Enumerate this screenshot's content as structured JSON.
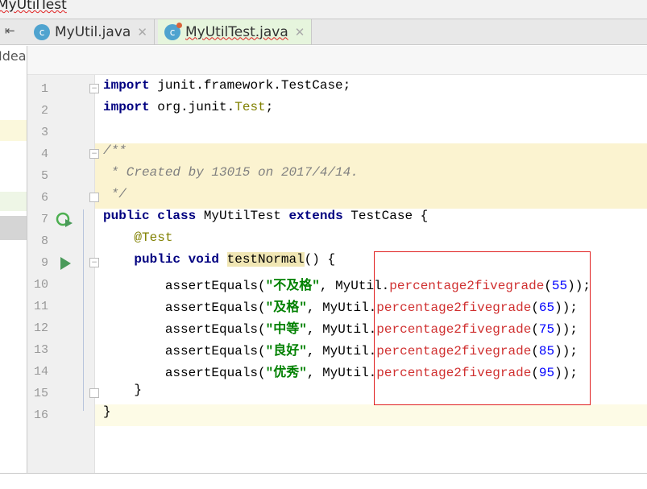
{
  "breadcrumb": {
    "item": "MyUtilTest"
  },
  "tabs": [
    {
      "label": "MyUtil.java",
      "active": false
    },
    {
      "label": "MyUtilTest.java",
      "active": true
    }
  ],
  "left_panel": {
    "label": "IdeaP"
  },
  "colors": {
    "keyword": "#000080",
    "string": "#008000",
    "number": "#0000ff",
    "method": "#d03030",
    "annotation": "#808000",
    "highlight_box": "#e02020"
  },
  "lines": [
    [
      [
        "kw",
        "import"
      ],
      [
        "",
        "junit.framework.TestCase;"
      ]
    ],
    [
      [
        "kw",
        "import"
      ],
      [
        "",
        "org.junit."
      ],
      [
        "an",
        "Test"
      ],
      [
        "",
        ";"
      ]
    ],
    [],
    [
      [
        "cm",
        "/**"
      ]
    ],
    [
      [
        "cm",
        " * Created by 13015 on 2017/4/14."
      ]
    ],
    [
      [
        "cm",
        " */"
      ]
    ],
    [
      [
        "kw",
        "public class "
      ],
      [
        "",
        "MyUtilTest "
      ],
      [
        "kw",
        "extends "
      ],
      [
        "",
        "TestCase {"
      ]
    ],
    [
      [
        "an",
        "    @Test"
      ]
    ],
    [
      [
        "kw",
        "    public void "
      ],
      [
        "hl",
        "testNormal"
      ],
      [
        "",
        "() {"
      ]
    ],
    [
      [
        "",
        "        assertEquals("
      ],
      [
        "st",
        "\"不及格\""
      ],
      [
        "",
        ", MyUtil."
      ],
      [
        "mt",
        "percentage2fivegrade"
      ],
      [
        "",
        "("
      ],
      [
        "nm",
        "55"
      ],
      [
        "",
        "));"
      ]
    ],
    [
      [
        "",
        "        assertEquals("
      ],
      [
        "st",
        "\"及格\""
      ],
      [
        "",
        ", MyUtil."
      ],
      [
        "mt",
        "percentage2fivegrade"
      ],
      [
        "",
        "("
      ],
      [
        "nm",
        "65"
      ],
      [
        "",
        "));"
      ]
    ],
    [
      [
        "",
        "        assertEquals("
      ],
      [
        "st",
        "\"中等\""
      ],
      [
        "",
        ", MyUtil."
      ],
      [
        "mt",
        "percentage2fivegrade"
      ],
      [
        "",
        "("
      ],
      [
        "nm",
        "75"
      ],
      [
        "",
        "));"
      ]
    ],
    [
      [
        "",
        "        assertEquals("
      ],
      [
        "st",
        "\"良好\""
      ],
      [
        "",
        ", MyUtil."
      ],
      [
        "mt",
        "percentage2fivegrade"
      ],
      [
        "",
        "("
      ],
      [
        "nm",
        "85"
      ],
      [
        "",
        "));"
      ]
    ],
    [
      [
        "",
        "        assertEquals("
      ],
      [
        "st",
        "\"优秀\""
      ],
      [
        "",
        ", MyUtil."
      ],
      [
        "mt",
        "percentage2fivegrade"
      ],
      [
        "",
        "("
      ],
      [
        "nm",
        "95"
      ],
      [
        "",
        "));"
      ]
    ],
    [
      [
        "",
        "    }"
      ]
    ],
    [
      [
        "",
        "}"
      ]
    ]
  ]
}
